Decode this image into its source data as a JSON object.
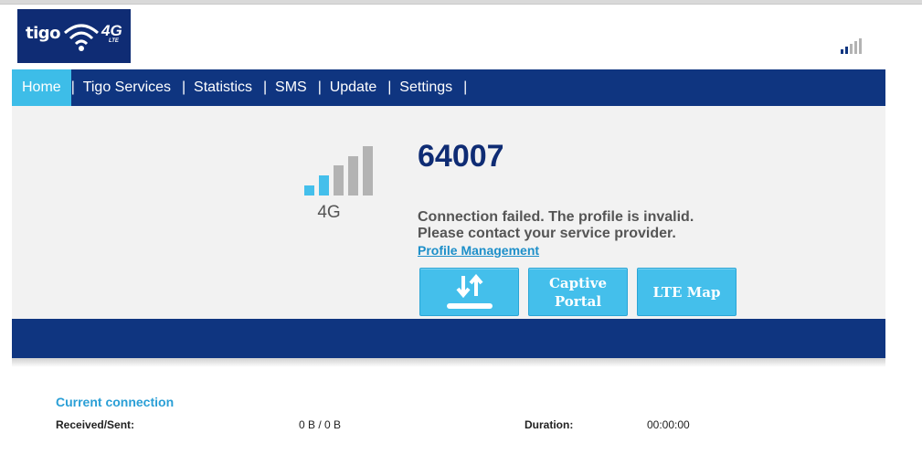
{
  "header": {
    "brand": "tigo",
    "logo_badge": "4G",
    "logo_sub": "LTE",
    "signal_icon": "signal-bars-icon"
  },
  "nav": {
    "items": [
      {
        "label": "Home",
        "active": true
      },
      {
        "label": "Tigo Services"
      },
      {
        "label": "Statistics"
      },
      {
        "label": "SMS"
      },
      {
        "label": "Update"
      },
      {
        "label": "Settings"
      }
    ],
    "separator": "|"
  },
  "status": {
    "network_type": "4G",
    "signal_level": "2 of 5 bars",
    "operator": "64007",
    "message_line1": "Connection failed. The profile is invalid.",
    "message_line2": "Please contact your service provider.",
    "profile_link": "Profile Management"
  },
  "buttons": {
    "data_icon": "upload-download-icon",
    "captive_portal": "Captive Portal",
    "lte_map": "LTE Map"
  },
  "current_connection": {
    "title": "Current connection",
    "received_sent_label": "Received/Sent:",
    "received_sent_value": "0 B /  0 B",
    "duration_label": "Duration:",
    "duration_value": "00:00:00"
  },
  "colors": {
    "navy": "#0f3580",
    "accent": "#44bfeb",
    "link": "#1d8fc9"
  }
}
